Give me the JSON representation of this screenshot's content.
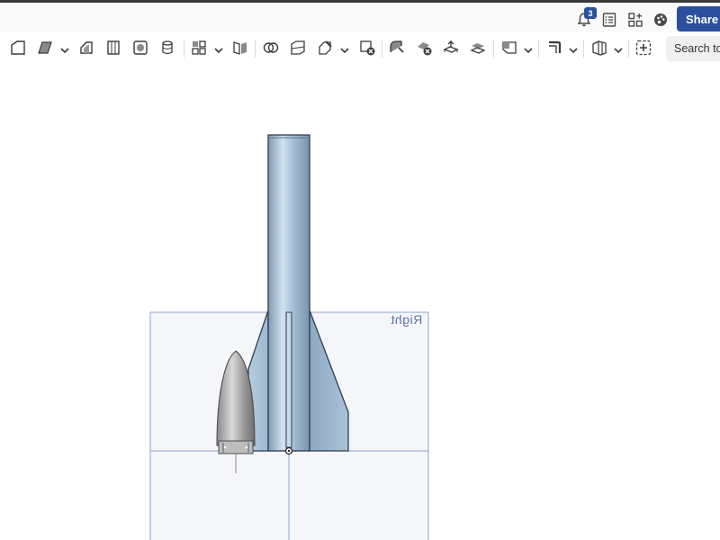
{
  "header": {
    "notification_count": "3",
    "share_label": "Share",
    "icons": [
      "bell-icon",
      "document-list-icon",
      "apps-grid-icon",
      "appearance-palette-icon"
    ]
  },
  "toolbar": {
    "tools": [
      "sketch-icon",
      "extrude-icon",
      "revolve-icon",
      "sweep-icon",
      "fillet-icon",
      "shell-icon",
      "pattern-icon",
      "mirror-icon",
      "boolean-icon",
      "split-icon",
      "transform-icon",
      "delete-part-icon",
      "modify-fillet-icon",
      "delete-face-icon",
      "move-face-icon",
      "replace-face-icon",
      "plane-icon",
      "sheet-metal-icon",
      "frame-icon",
      "add-feature-icon"
    ],
    "search_label": "Search to"
  },
  "viewport": {
    "view_cube_label": "Right"
  },
  "colors": {
    "accent": "#2b4f9c",
    "model_body": "#a9c2d8",
    "plane_fill": "#f4f6fa",
    "plane_edge": "#9fb4d6",
    "nose_cone": "#9a9a9a"
  }
}
